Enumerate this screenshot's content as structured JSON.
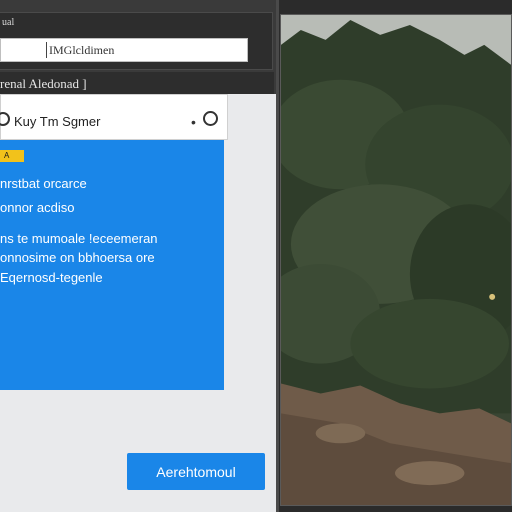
{
  "top_bar": {
    "label": "ual",
    "name_field_value": "IMGlcldimen"
  },
  "sub_bar": {
    "label": "renal  Aledonad ]"
  },
  "search": {
    "text": "Kuy Tm Sgmer"
  },
  "card": {
    "badge": "A",
    "lines": [
      "nrstbat orcarce",
      "onnor acdiso",
      "ns te mumoale !eceemeran",
      "onnosime on bbhoersa ore",
      "Eqernosd-tegenle"
    ]
  },
  "action_button": {
    "label": "Aerehtomoul"
  },
  "photo": {
    "subject": "landscape-photo"
  },
  "colors": {
    "accent": "#1a86e8",
    "badge": "#f2c21b",
    "panel_dark": "#2d2d2d",
    "content_bg": "#e9eaec"
  }
}
